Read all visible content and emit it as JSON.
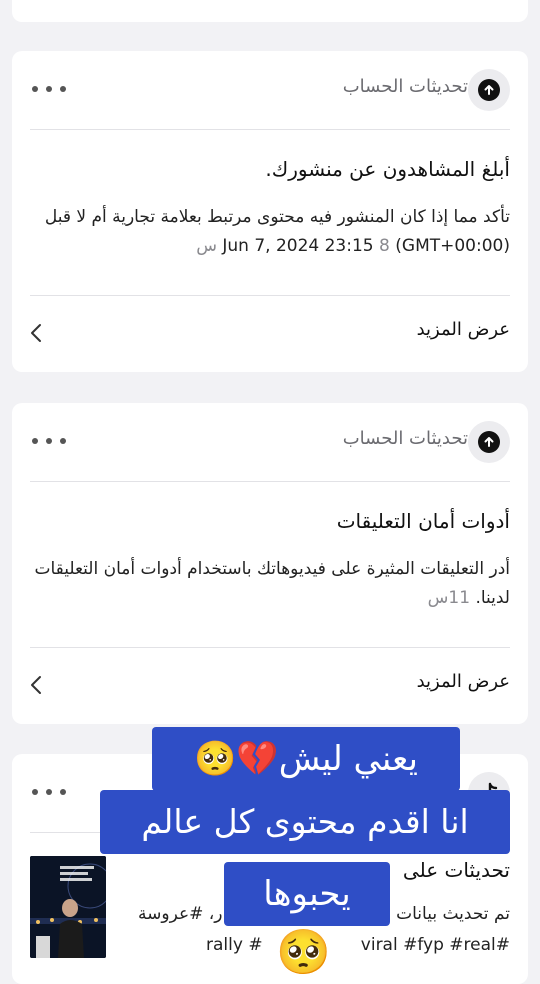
{
  "cards": [
    {
      "header_title": "تحديثات الحساب",
      "title": "أبلغ المشاهدون عن منشورك.",
      "body": "تأكد مما إذا كان المنشور فيه محتوى مرتبط بعلامة تجارية أم لا قبل (GMT+00:00) Jun 7, 2024 23:15",
      "timestamp": "8 س",
      "more_label": "عرض المزيد"
    },
    {
      "header_title": "تحديثات الحساب",
      "title": "أدوات أمان التعليقات",
      "body": "أدر التعليقات المثيرة على فيديوهاتك باستخدام أدوات أمان التعليقات لدينا.",
      "timestamp": "11س",
      "more_label": "عرض المزيد"
    },
    {
      "title": "تحديثات على",
      "body_line1": "تم تحديث بيانات",
      "body_line1_end": "ر، #عروسة",
      "body_line2_left": "rally #",
      "body_line2_right": "viral #fyp #real#"
    }
  ],
  "overlay": {
    "line1": "يعني ليش💔🥺",
    "line2": "انا اقدم محتوى كل عالم",
    "line3": "يحبوها",
    "emoji": "🥺"
  },
  "icons": {
    "header_icon": "arrow-up-circle-icon",
    "menu_icon": "more-dots-icon",
    "chevron_icon": "chevron-left-icon"
  },
  "colors": {
    "overlay_bg": "#2f4ec6",
    "page_bg": "#f2f2f5"
  }
}
